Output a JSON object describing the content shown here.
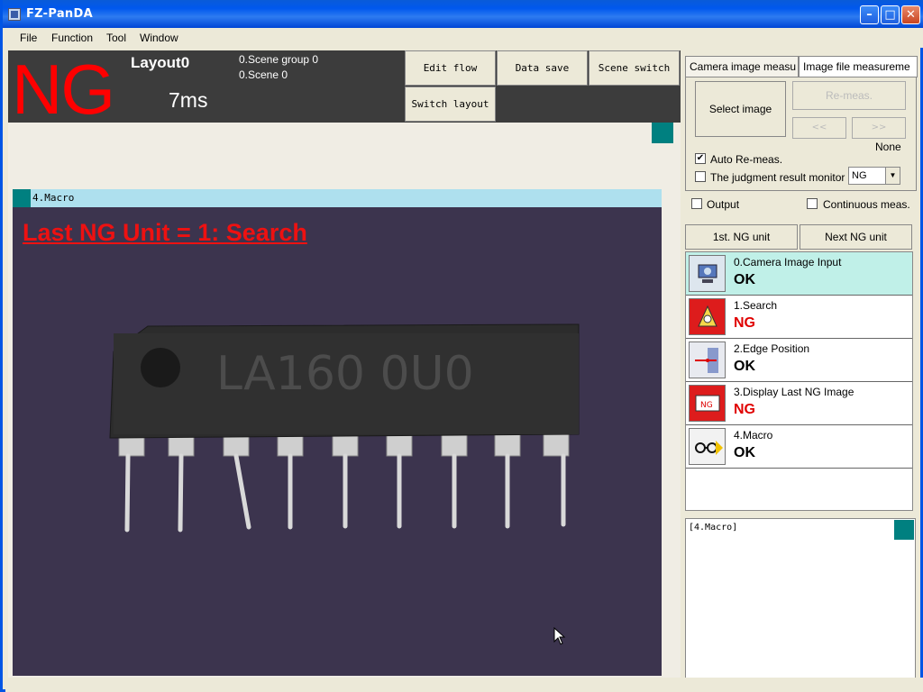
{
  "window": {
    "title": "FZ-PanDA"
  },
  "menu": [
    "File",
    "Function",
    "Tool",
    "Window"
  ],
  "header": {
    "judgement": "NG",
    "layout": "Layout0",
    "time": "7ms",
    "scene_group": "0.Scene group 0",
    "scene": "0.Scene 0",
    "buttons": {
      "edit_flow": "Edit flow",
      "data_save": "Data save",
      "scene_switch": "Scene switch",
      "switch_layout": "Switch layout"
    }
  },
  "image_window": {
    "title": "4.Macro",
    "caption": "Last NG Unit = 1: Search",
    "chip_label": "LA160 0U0"
  },
  "panel": {
    "tabs": [
      "Camera image measu",
      "Image file measureme"
    ],
    "select_image": "Select image",
    "remeas": "Re-meas.",
    "prev": "<<",
    "next": ">>",
    "file_name": "None",
    "auto_remeas": "Auto Re-meas.",
    "auto_remeas_checked": true,
    "monitor_label": "The judgment result monitor",
    "monitor_value": "NG",
    "output": "Output",
    "continuous": "Continuous meas.",
    "first_ng": "1st. NG unit",
    "next_ng": "Next NG unit",
    "flow": [
      {
        "name": "0.Camera Image Input",
        "result": "OK",
        "icon": "camera-input-icon"
      },
      {
        "name": "1.Search",
        "result": "NG",
        "icon": "search-icon"
      },
      {
        "name": "2.Edge Position",
        "result": "OK",
        "icon": "edge-position-icon"
      },
      {
        "name": "3.Display Last NG Image",
        "result": "NG",
        "icon": "display-ng-image-icon"
      },
      {
        "name": "4.Macro",
        "result": "OK",
        "icon": "macro-icon"
      }
    ],
    "detail_title": "[4.Macro]"
  },
  "colors": {
    "ng": "#ff0000",
    "ok": "#000000",
    "selected_row": "#c0f0e8",
    "accent": "#008080"
  }
}
